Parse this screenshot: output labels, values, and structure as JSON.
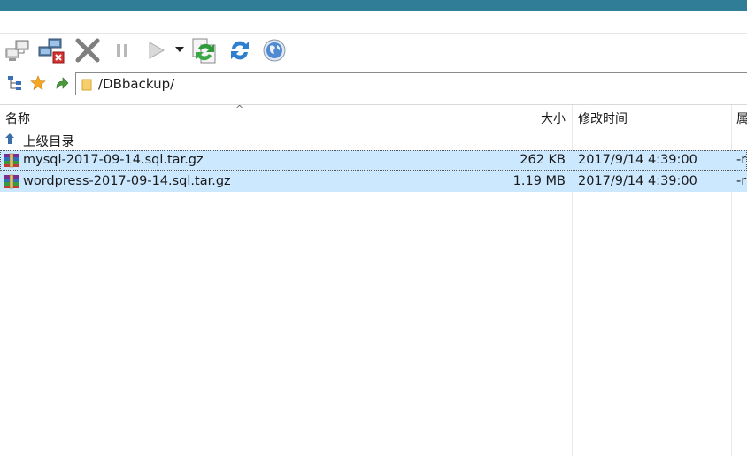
{
  "colors": {
    "top_band": "#2f7d96",
    "selection": "#cce8ff"
  },
  "toolbar": {
    "buttons": [
      {
        "name": "connect-icon"
      },
      {
        "name": "disconnect-icon"
      },
      {
        "name": "cancel-icon"
      },
      {
        "name": "pause-icon"
      },
      {
        "name": "play-icon"
      },
      {
        "name": "sync-icon"
      },
      {
        "name": "refresh-icon"
      },
      {
        "name": "globe-icon"
      }
    ]
  },
  "address": {
    "path": "/DBbackup/"
  },
  "columns": {
    "name": "名称",
    "size": "大小",
    "modified": "修改时间",
    "attr": "属"
  },
  "rows": [
    {
      "name": "上级目录",
      "size": "",
      "modified": "",
      "attr": ""
    },
    {
      "name": "mysql-2017-09-14.sql.tar.gz",
      "size": "262 KB",
      "modified": "2017/9/14 4:39:00",
      "attr": "-r"
    },
    {
      "name": "wordpress-2017-09-14.sql.tar.gz",
      "size": "1.19 MB",
      "modified": "2017/9/14 4:39:00",
      "attr": "-r"
    }
  ]
}
